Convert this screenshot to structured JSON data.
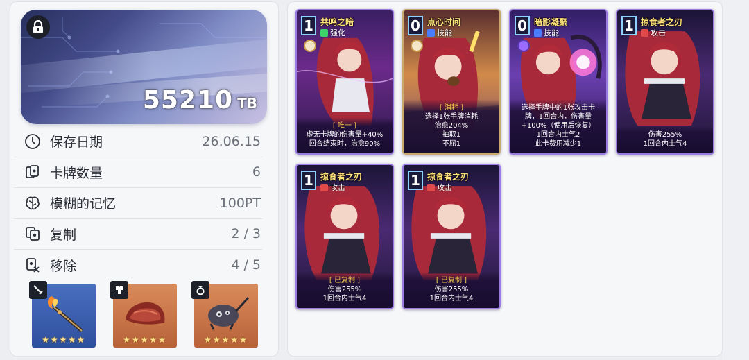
{
  "hero": {
    "value": "55210",
    "unit": "TB",
    "lock_icon": "lock-icon"
  },
  "info": [
    {
      "icon": "clock-icon",
      "label": "保存日期",
      "value": "26.06.15"
    },
    {
      "icon": "cards-icon",
      "label": "卡牌数量",
      "value": "6"
    },
    {
      "icon": "brain-icon",
      "label": "模糊的记忆",
      "value": "100PT"
    },
    {
      "icon": "copy-icon",
      "label": "复制",
      "value": "2 / 3"
    },
    {
      "icon": "remove-icon",
      "label": "移除",
      "value": "4 / 5"
    }
  ],
  "gear": [
    {
      "slot": "weapon",
      "badge_icon": "sword-icon",
      "stars": "★★★★★",
      "color": "#3a5fae"
    },
    {
      "slot": "armor",
      "badge_icon": "armor-icon",
      "stars": "★★★★★",
      "color": "#c4704a"
    },
    {
      "slot": "accessory",
      "badge_icon": "ring-icon",
      "stars": "★★★★★",
      "color": "#c4704a"
    }
  ],
  "cards": [
    {
      "cost": "1",
      "title": "共鸣之暗",
      "type": "强化",
      "type_color": "#3dd36b",
      "tag": "[ 唯一 ]",
      "lines": [
        "虚无卡牌的伤害量+40%",
        "回合结束时，治愈90%"
      ]
    },
    {
      "cost": "0",
      "title": "点心时间",
      "type": "技能",
      "type_color": "#4a7cff",
      "tag": "[ 消耗 ]",
      "lines": [
        "选择1张手牌消耗",
        "治愈204%",
        "抽取1",
        "不屈1"
      ]
    },
    {
      "cost": "0",
      "title": "暗影凝聚",
      "type": "技能",
      "type_color": "#4a7cff",
      "tag": "",
      "lines": [
        "选择手牌中的1张攻击卡",
        "牌，1回合内，伤害量",
        "+100%（使用后恢复）",
        "1回合内士气2",
        "此卡费用减少1"
      ]
    },
    {
      "cost": "1",
      "title": "掠食者之刃",
      "type": "攻击",
      "type_color": "#e04a4a",
      "tag": "",
      "lines": [
        "伤害255%",
        "1回合内士气4"
      ]
    },
    {
      "cost": "1",
      "title": "掠食者之刃",
      "type": "攻击",
      "type_color": "#e04a4a",
      "tag": "[ 已复制 ]",
      "lines": [
        "伤害255%",
        "1回合内士气4"
      ]
    },
    {
      "cost": "1",
      "title": "掠食者之刃",
      "type": "攻击",
      "type_color": "#e04a4a",
      "tag": "[ 已复制 ]",
      "lines": [
        "伤害255%",
        "1回合内士气4"
      ]
    }
  ]
}
